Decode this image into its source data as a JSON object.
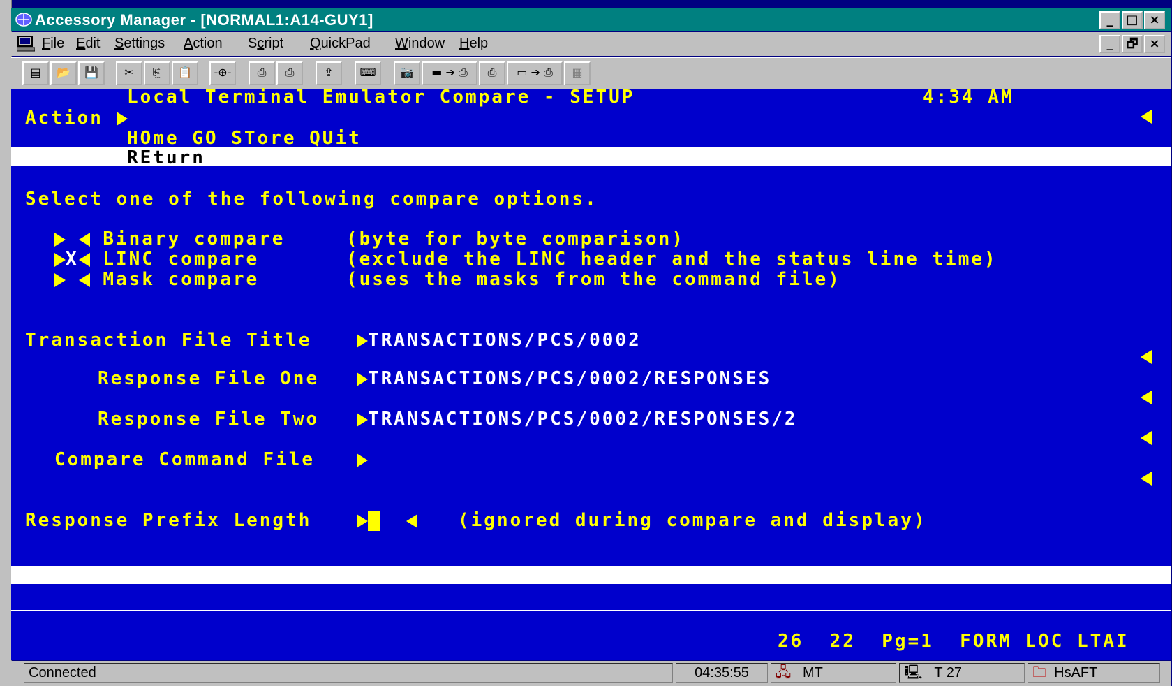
{
  "window": {
    "title": "Accessory Manager - [NORMAL1:A14-GUY1]",
    "min": "_",
    "max": "□",
    "close": "×",
    "restore": "🗗"
  },
  "menu": [
    "File",
    "Edit",
    "Settings",
    "Action",
    "Script",
    "QuickPad",
    "Window",
    "Help"
  ],
  "menu_underline": [
    "F",
    "E",
    "S",
    "A",
    "c",
    "Q",
    "W",
    "H"
  ],
  "terminal": {
    "header": "Local Terminal Emulator Compare - SETUP",
    "time": "4:34 AM",
    "action_label": "Action",
    "commands": "HOme GO STore QUit",
    "return_cmd": "REturn",
    "instruction": "Select one of the following compare options.",
    "options": [
      {
        "mark": " ",
        "label": "Binary compare",
        "desc": "(byte for byte comparison)"
      },
      {
        "mark": "X",
        "label": "LINC compare",
        "desc": "(exclude the LINC header and the status line time)"
      },
      {
        "mark": " ",
        "label": "Mask compare",
        "desc": "(uses the masks from the command file)"
      }
    ],
    "fields": [
      {
        "label": "Transaction File Title",
        "value": "TRANSACTIONS/PCS/0002"
      },
      {
        "label": "Response File One",
        "value": "TRANSACTIONS/PCS/0002/RESPONSES"
      },
      {
        "label": "Response File Two",
        "value": "TRANSACTIONS/PCS/0002/RESPONSES/2"
      },
      {
        "label": "Compare Command File",
        "value": ""
      }
    ],
    "prefix_label": "Response Prefix Length",
    "prefix_note": "(ignored during compare and display)",
    "status_line": "26  22  Pg=1  FORM LOC LTAI"
  },
  "statusbar": {
    "connection": "Connected",
    "clock": "04:35:55",
    "mode1": "MT",
    "mode2": "T 27",
    "mode3": "HsAFT"
  }
}
